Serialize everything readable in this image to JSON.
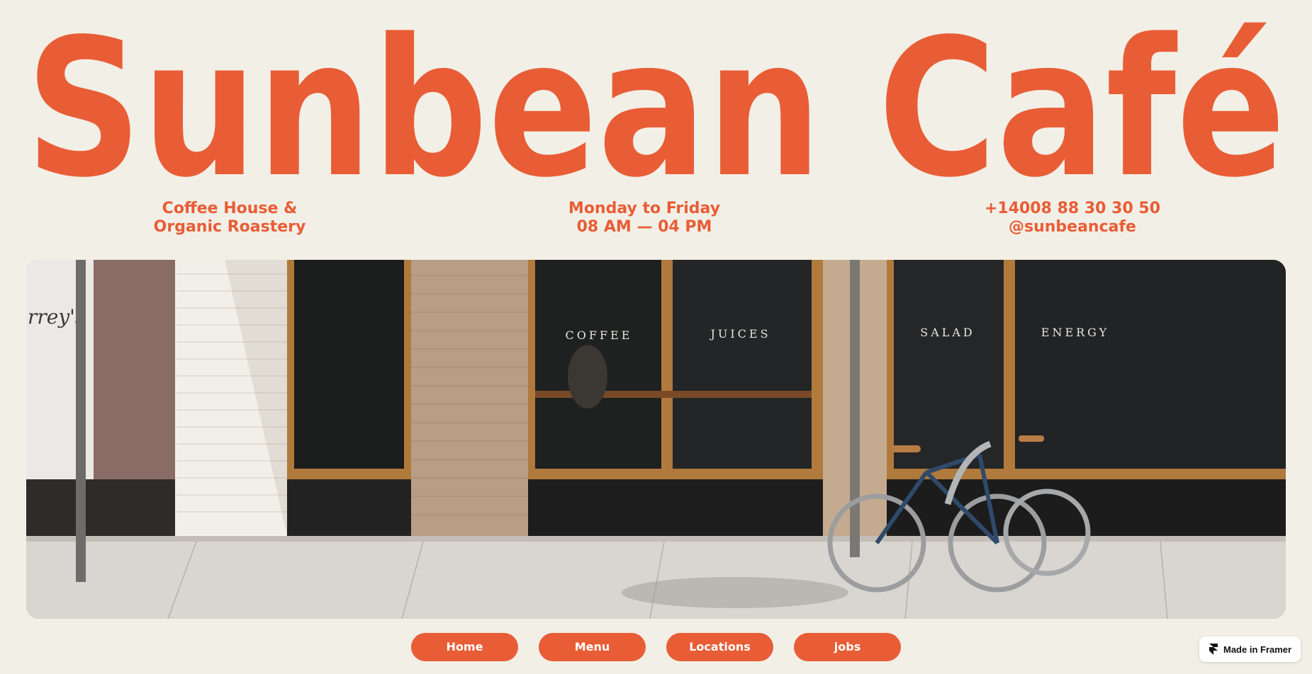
{
  "brand": {
    "title": "Sunbean Café",
    "color": "#e85d36"
  },
  "info": {
    "tagline": [
      "Coffee House &",
      "Organic Roastery"
    ],
    "hours": [
      "Monday to Friday",
      "08 AM — 04 PM"
    ],
    "contact": [
      "+14008 88 30 30 50",
      "@sunbeancafe"
    ]
  },
  "hero": {
    "window_signs": [
      "COFFEE",
      "JUICES",
      "SALAD",
      "ENERGY"
    ]
  },
  "nav": {
    "items": [
      "Home",
      "Menu",
      "Locations",
      "jobs"
    ],
    "button_color": "#e85d36"
  },
  "badge": {
    "label": "Made in Framer",
    "icon": "framer-icon"
  },
  "colors": {
    "background": "#f2efe6",
    "accent": "#e85d36"
  }
}
